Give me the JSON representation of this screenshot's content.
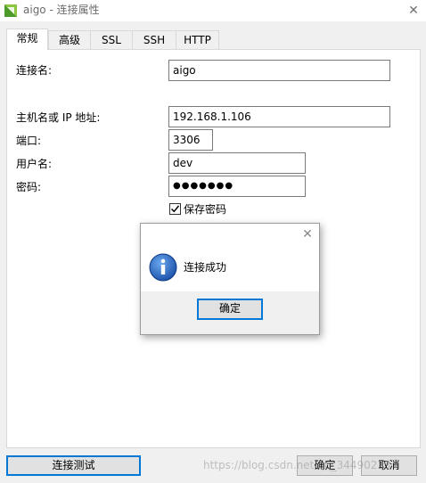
{
  "window": {
    "title": "aigo - 连接属性",
    "close_glyph": "✕"
  },
  "tabs": [
    {
      "label": "常规",
      "active": true
    },
    {
      "label": "高级",
      "active": false
    },
    {
      "label": "SSL",
      "active": false
    },
    {
      "label": "SSH",
      "active": false
    },
    {
      "label": "HTTP",
      "active": false
    }
  ],
  "form": {
    "connection_name_label": "连接名:",
    "connection_name_value": "aigo",
    "host_label": "主机名或 IP 地址:",
    "host_value": "192.168.1.106",
    "port_label": "端口:",
    "port_value": "3306",
    "username_label": "用户名:",
    "username_value": "dev",
    "password_label": "密码:",
    "password_value": "●●●●●●●",
    "save_password_label": "保存密码",
    "save_password_checked": true
  },
  "dialog": {
    "close_glyph": "✕",
    "message": "连接成功",
    "ok_label": "确定",
    "icon": "info-icon"
  },
  "footer": {
    "test_button": "连接测试",
    "ok_button": "确定",
    "cancel_button": "取消"
  },
  "watermark": "https://blog.csdn.net/qq_34490233",
  "colors": {
    "accent_blue": "#0078d7",
    "app_icon_green": "#6fbf3a",
    "info_icon_blue": "#1f5fbf"
  }
}
